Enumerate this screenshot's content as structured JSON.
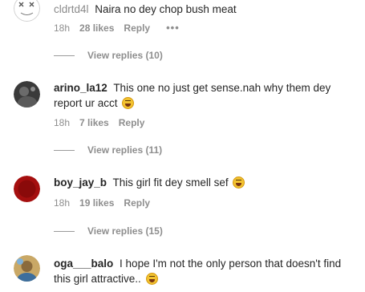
{
  "comments": [
    {
      "username": "cldrtd4l",
      "text": "Naira no dey chop bush meat",
      "time": "18h",
      "likes": "28 likes",
      "reply_label": "Reply",
      "more": "•••",
      "view_replies": "View replies (10)"
    },
    {
      "username": "arino_la12",
      "text": "This one no just get sense.nah why them dey report ur acct",
      "time": "18h",
      "likes": "7 likes",
      "reply_label": "Reply",
      "view_replies": "View replies (11)"
    },
    {
      "username": "boy_jay_b",
      "text": "This girl fit dey smell sef",
      "time": "18h",
      "likes": "19 likes",
      "reply_label": "Reply",
      "view_replies": "View replies (15)"
    },
    {
      "username": "oga___balo",
      "text": "I hope I'm not the only person that doesn't find this girl attractive..",
      "time": "",
      "likes": "",
      "reply_label": "",
      "view_replies": ""
    }
  ],
  "colors": {
    "text": "#262626",
    "muted": "#8e8e8e",
    "emoji": "#f2c230",
    "avatar_red": "#a50f0f"
  }
}
